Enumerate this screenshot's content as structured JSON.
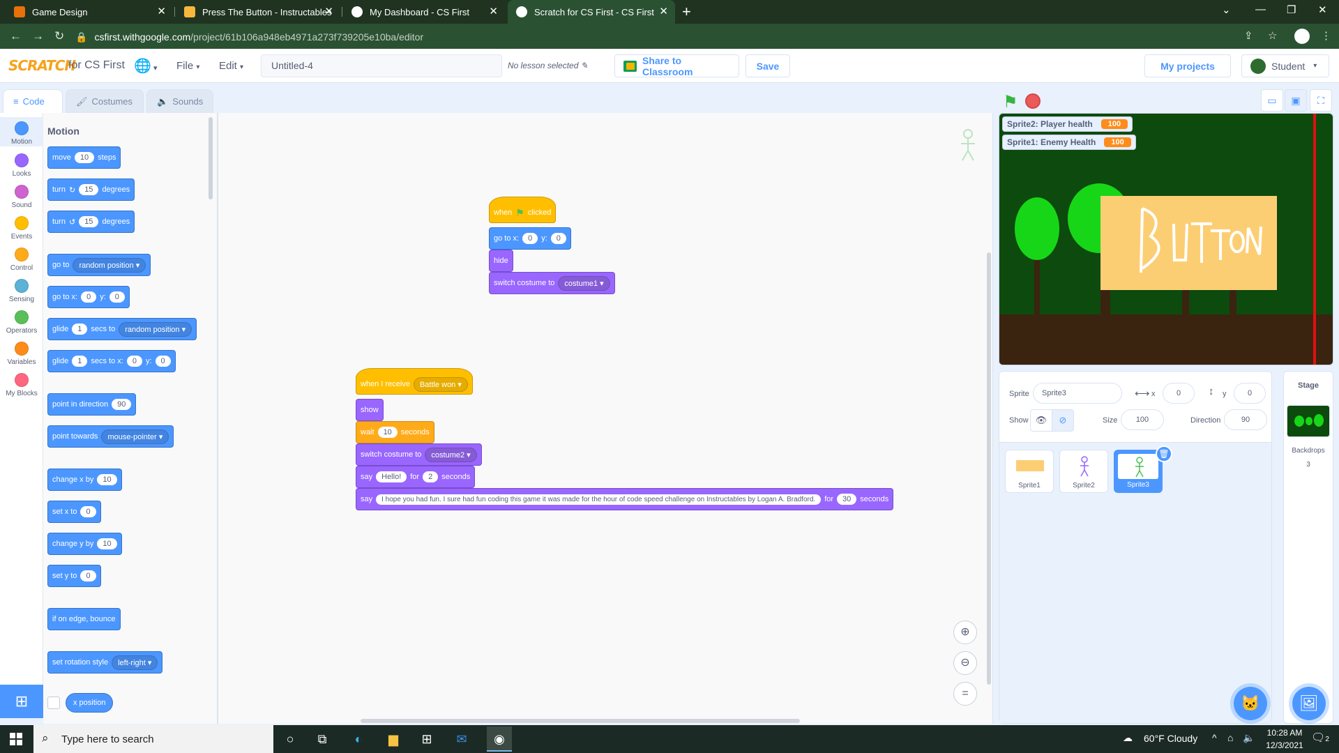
{
  "browser": {
    "tabs": [
      {
        "title": "Game Design",
        "color": "#e8710a"
      },
      {
        "title": "Press The Button - Instructables",
        "color": "#f6b73c"
      },
      {
        "title": "My Dashboard - CS First",
        "color": "#ffffff"
      },
      {
        "title": "Scratch for CS First - CS First",
        "color": "#ffffff"
      }
    ],
    "url_host": "csfirst.withgoogle.com",
    "url_path": "/project/61b106a948eb4971a273f739205e10ba/editor"
  },
  "menubar": {
    "logo": "SCRATCH",
    "logo_sub": "for CS First",
    "file": "File",
    "edit": "Edit",
    "project_title": "Untitled-4",
    "lesson": "No lesson selected",
    "share": "Share to Classroom",
    "save": "Save",
    "my_projects": "My projects",
    "user": "Student"
  },
  "editor_tabs": {
    "code": "Code",
    "costumes": "Costumes",
    "sounds": "Sounds"
  },
  "categories": [
    {
      "label": "Motion",
      "color": "#4c97ff"
    },
    {
      "label": "Looks",
      "color": "#9966ff"
    },
    {
      "label": "Sound",
      "color": "#cf63cf"
    },
    {
      "label": "Events",
      "color": "#ffbf00"
    },
    {
      "label": "Control",
      "color": "#ffab19"
    },
    {
      "label": "Sensing",
      "color": "#5cb1d6"
    },
    {
      "label": "Operators",
      "color": "#59c059"
    },
    {
      "label": "Variables",
      "color": "#ff8c1a"
    },
    {
      "label": "My Blocks",
      "color": "#ff6680"
    }
  ],
  "palette": {
    "heading": "Motion",
    "move": {
      "label": "move",
      "value": "10",
      "suffix": "steps"
    },
    "turn_right": {
      "label": "turn",
      "value": "15",
      "suffix": "degrees"
    },
    "turn_left": {
      "label": "turn",
      "value": "15",
      "suffix": "degrees"
    },
    "goto": {
      "label": "go to",
      "dropdown": "random position"
    },
    "goto_xy": {
      "label": "go to x:",
      "x": "0",
      "ylabel": "y:",
      "y": "0"
    },
    "glide_to": {
      "label": "glide",
      "value": "1",
      "mid": "secs to",
      "dropdown": "random position"
    },
    "glide_xy": {
      "label": "glide",
      "value": "1",
      "mid": "secs to x:",
      "x": "0",
      "ylabel": "y:",
      "y": "0"
    },
    "point_dir": {
      "label": "point in direction",
      "value": "90"
    },
    "point_towards": {
      "label": "point towards",
      "dropdown": "mouse-pointer"
    },
    "change_x": {
      "label": "change x by",
      "value": "10"
    },
    "set_x": {
      "label": "set x to",
      "value": "0"
    },
    "change_y": {
      "label": "change y by",
      "value": "10"
    },
    "set_y": {
      "label": "set y to",
      "value": "0"
    },
    "bounce": {
      "label": "if on edge, bounce"
    },
    "rotation": {
      "label": "set rotation style",
      "dropdown": "left-right"
    },
    "x_position": {
      "label": "x position"
    }
  },
  "scripts": {
    "s1": {
      "hat": {
        "when": "when",
        "clicked": "clicked"
      },
      "goto": {
        "label": "go to x:",
        "x": "0",
        "ylabel": "y:",
        "y": "0"
      },
      "hide": "hide",
      "costume": {
        "label": "switch costume to",
        "value": "costume1"
      }
    },
    "s2": {
      "hat": {
        "label": "when I receive",
        "value": "Battle won"
      },
      "show": "show",
      "wait": {
        "label": "wait",
        "value": "10",
        "suffix": "seconds"
      },
      "costume": {
        "label": "switch costume to",
        "value": "costume2"
      },
      "say1": {
        "label": "say",
        "value": "Hello!",
        "mid": "for",
        "secs": "2",
        "suffix": "seconds"
      },
      "say2": {
        "label": "say",
        "value": "I hope you had fun. I sure had fun coding this game it was made for the hour of code speed challenge on Instructables by Logan A. Bradford.",
        "mid": "for",
        "secs": "30",
        "suffix": "seconds"
      }
    }
  },
  "stage": {
    "monitors": [
      {
        "label": "Sprite2: Player health",
        "value": "100"
      },
      {
        "label": "Sprite1: Enemy Health",
        "value": "100"
      }
    ],
    "button_text": "BUttON"
  },
  "sprite_info": {
    "sprite_label": "Sprite",
    "sprite_name": "Sprite3",
    "x_label": "x",
    "x": "0",
    "y_label": "y",
    "y": "0",
    "show_label": "Show",
    "size_label": "Size",
    "size": "100",
    "direction_label": "Direction",
    "direction": "90"
  },
  "sprites": [
    {
      "name": "Sprite1"
    },
    {
      "name": "Sprite2"
    },
    {
      "name": "Sprite3"
    }
  ],
  "stage_pane": {
    "title": "Stage",
    "backdrops_label": "Backdrops",
    "backdrops_count": "3"
  },
  "taskbar": {
    "search_placeholder": "Type here to search",
    "weather": "60°F  Cloudy",
    "time": "10:28 AM",
    "date": "12/3/2021",
    "notifications": "2"
  }
}
